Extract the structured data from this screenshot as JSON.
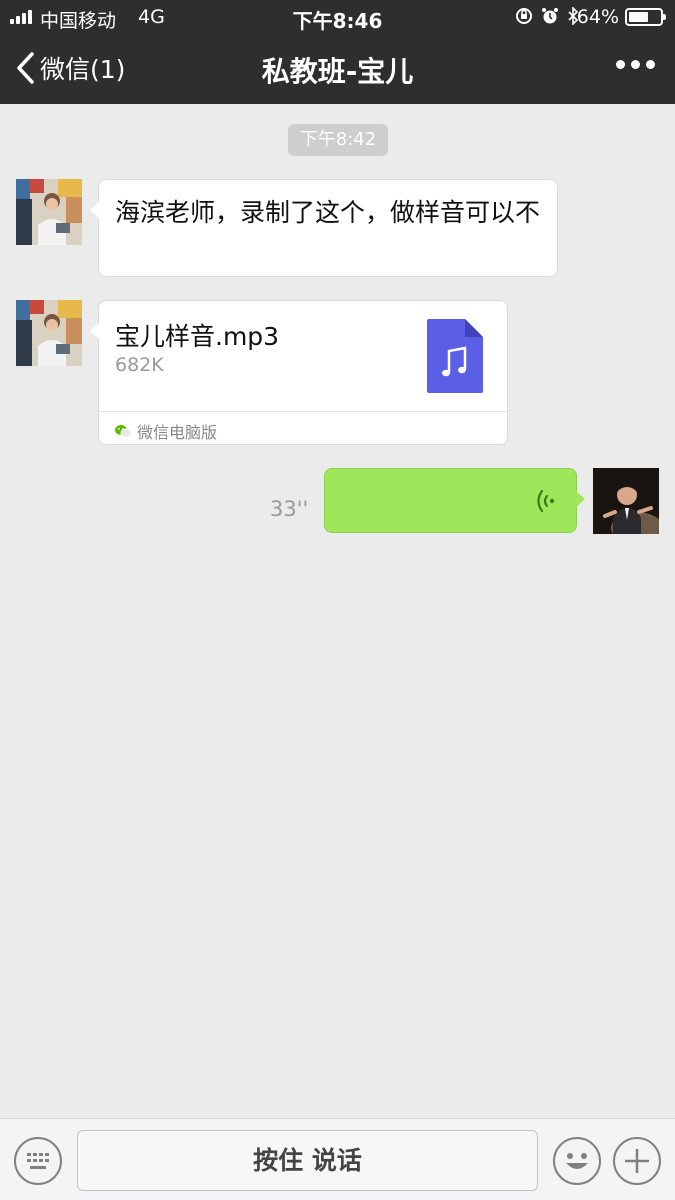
{
  "status_bar": {
    "carrier": "中国移动",
    "network": "4G",
    "time": "下午8:46",
    "battery_pct_label": "64%",
    "battery_level": 0.64
  },
  "nav": {
    "back_label": "微信(1)",
    "title": "私教班-宝儿"
  },
  "chat": {
    "timestamp": "下午8:42",
    "messages": [
      {
        "type": "text",
        "side": "left",
        "text": "海滨老师，录制了这个，做样音可以不"
      },
      {
        "type": "file",
        "side": "left",
        "file_name": "宝儿样音.mp3",
        "file_size": "682K",
        "source": "微信电脑版"
      },
      {
        "type": "voice",
        "side": "right",
        "duration": "33''"
      }
    ]
  },
  "input_bar": {
    "talk_label": "按住 说话"
  },
  "colors": {
    "nav_bg": "#2e2e2e",
    "chat_bg": "#ebebeb",
    "voice_bubble": "#9fe65a",
    "file_icon": "#5b5fe6"
  }
}
